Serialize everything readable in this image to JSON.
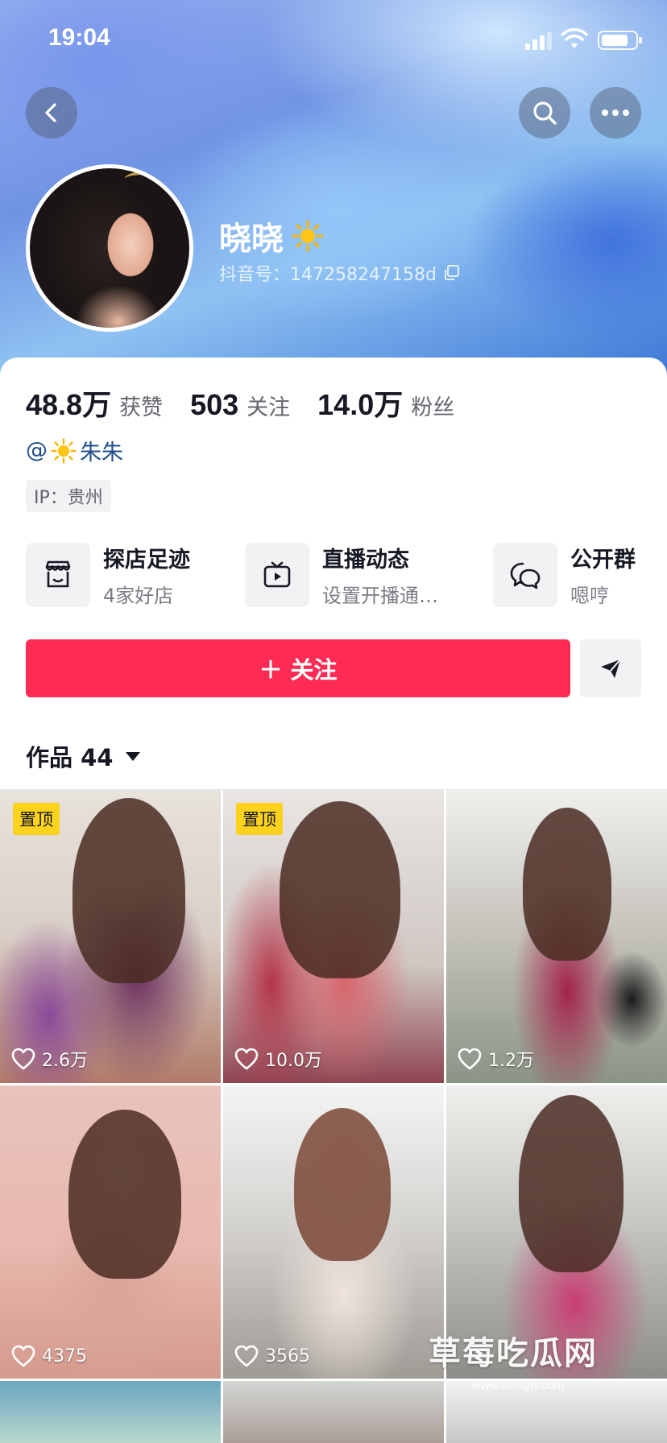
{
  "status_bar": {
    "time": "19:04"
  },
  "profile": {
    "name": "晓晓",
    "douyin_id": "抖音号：147258247158d",
    "stats": [
      {
        "value": "48.8万",
        "label": "获赞"
      },
      {
        "value": "503",
        "label": "关注"
      },
      {
        "value": "14.0万",
        "label": "粉丝"
      }
    ],
    "mention": {
      "at": "@",
      "name": "朱朱"
    },
    "ip": "IP：贵州"
  },
  "shortcuts": [
    {
      "title": "探店足迹",
      "subtitle": "4家好店",
      "icon": "store-icon"
    },
    {
      "title": "直播动态",
      "subtitle": "设置开播通…",
      "icon": "tv-icon"
    },
    {
      "title": "公开群",
      "subtitle": "嗯哼",
      "icon": "chat-group-icon"
    }
  ],
  "actions": {
    "follow_label": "＋ 关注"
  },
  "works": {
    "tab_label": "作品 44"
  },
  "videos": [
    {
      "pinned": "置顶",
      "likes": "2.6万"
    },
    {
      "pinned": "置顶",
      "likes": "10.0万"
    },
    {
      "pinned": "",
      "likes": "1.2万"
    },
    {
      "pinned": "",
      "likes": "4375"
    },
    {
      "pinned": "",
      "likes": "3565"
    },
    {
      "pinned": "",
      "likes": ""
    }
  ],
  "watermark": {
    "text": "草莓吃瓜网",
    "url": "www.cmcgw.com"
  },
  "colors": {
    "accent": "#fe2c55",
    "pinned_badge": "#fcd21c",
    "link": "#1f4e8c"
  }
}
